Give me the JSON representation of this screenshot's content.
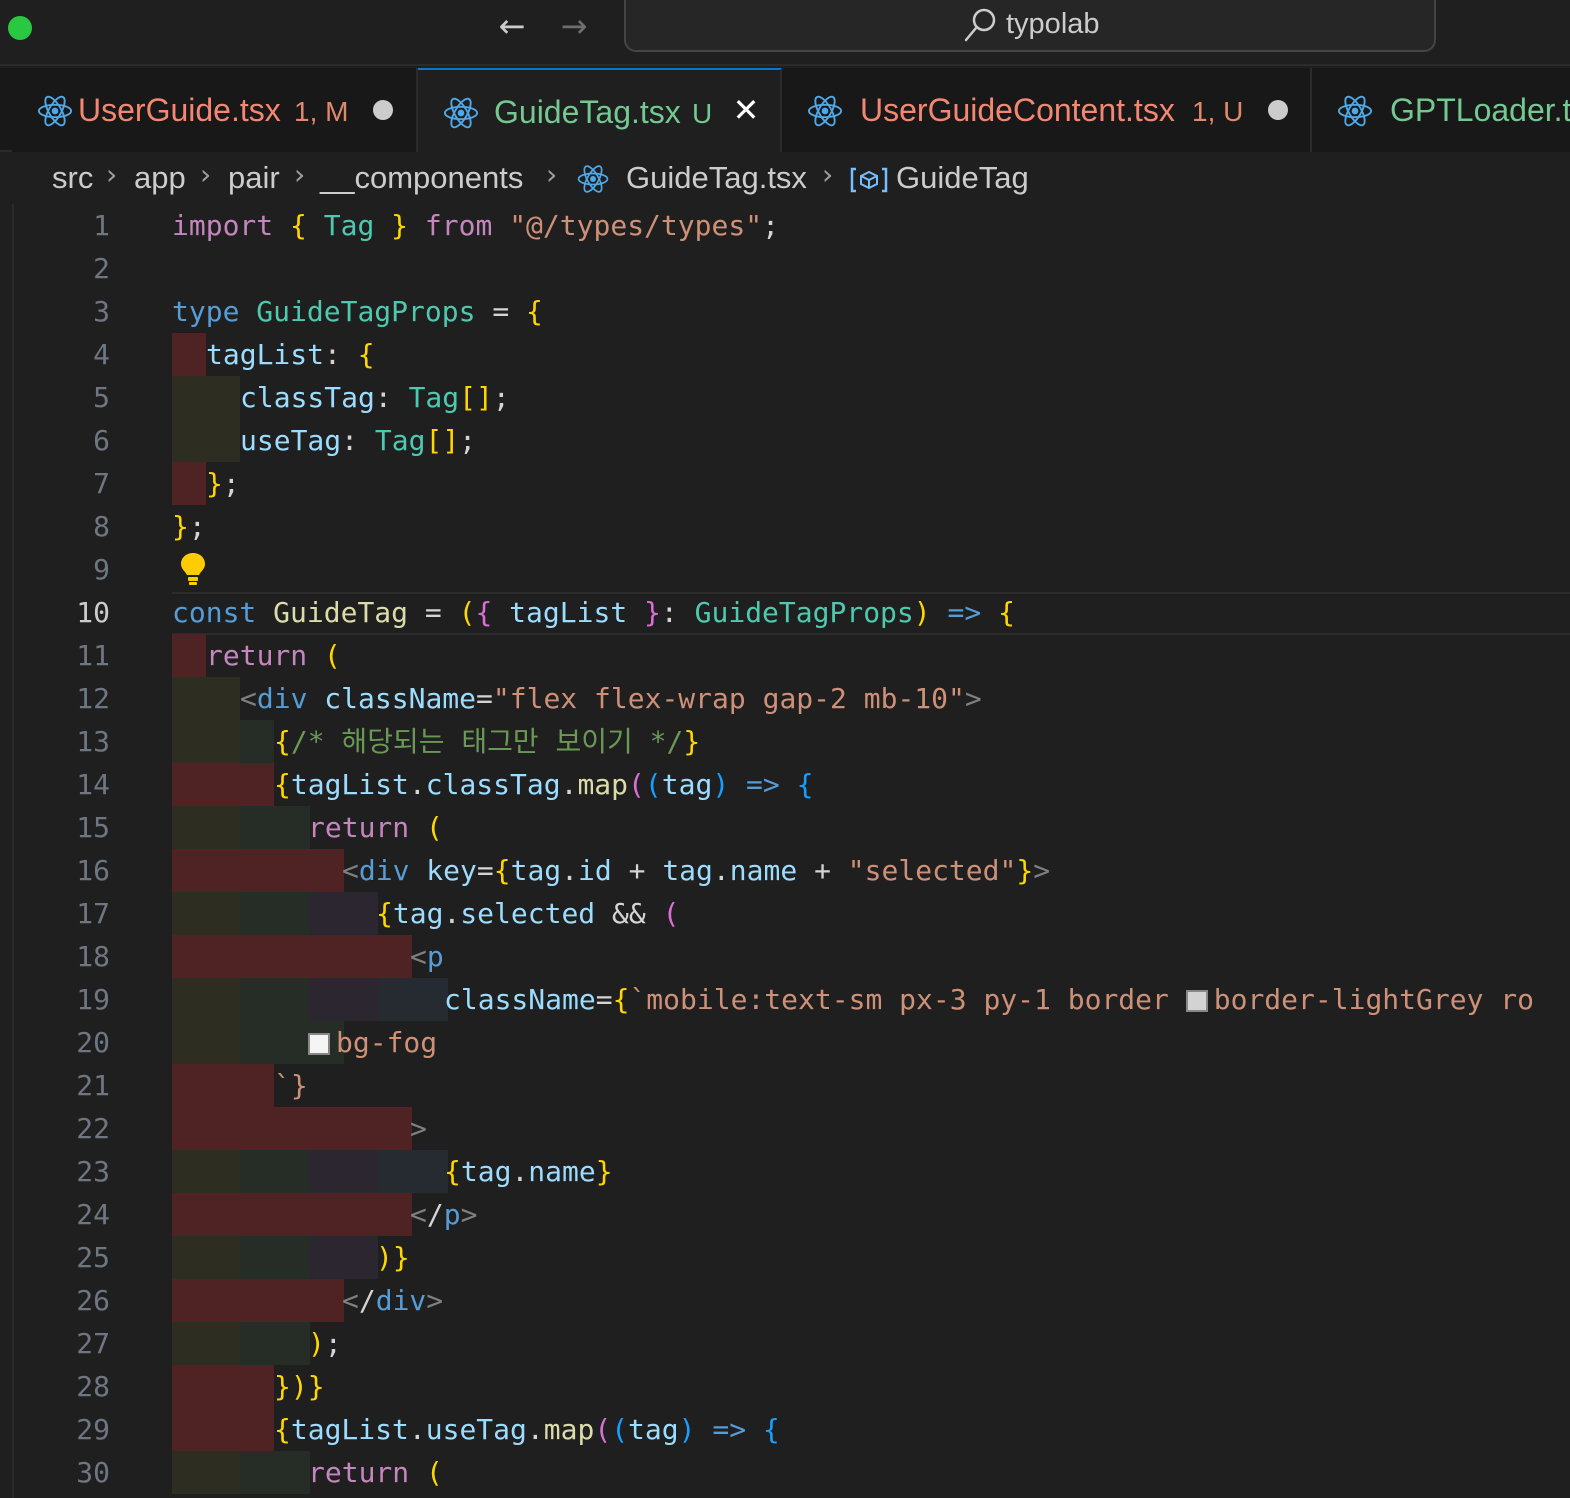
{
  "window": {
    "search_text": "typolab"
  },
  "tabs": [
    {
      "name": "UserGuide.tsx",
      "status": "1, M",
      "modified": true,
      "active": false
    },
    {
      "name": "GuideTag.tsx",
      "status": "U",
      "modified": false,
      "active": true
    },
    {
      "name": "UserGuideContent.tsx",
      "status": "1, U",
      "modified": true,
      "active": false
    },
    {
      "name": "GPTLoader.t",
      "status": "",
      "modified": false,
      "active": false
    }
  ],
  "breadcrumb": [
    "src",
    "app",
    "pair",
    "__components",
    "GuideTag.tsx",
    "GuideTag"
  ],
  "editor": {
    "current_line": 10,
    "line_numbers": [
      "1",
      "2",
      "3",
      "4",
      "5",
      "6",
      "7",
      "8",
      "9",
      "10",
      "11",
      "12",
      "13",
      "14",
      "15",
      "16",
      "17",
      "18",
      "19",
      "20",
      "21",
      "22",
      "23",
      "24",
      "25",
      "26",
      "27",
      "28",
      "29",
      "30"
    ],
    "lines": [
      "import { Tag } from \"@/types/types\";",
      "",
      "type GuideTagProps = {",
      "  tagList: {",
      "    classTag: Tag[];",
      "    useTag: Tag[];",
      "  };",
      "};",
      "",
      "const GuideTag = ({ tagList }: GuideTagProps) => {",
      "  return (",
      "    <div className=\"flex flex-wrap gap-2 mb-10\">",
      "      {/* 해당되는 태그만 보이기 */}",
      "      {tagList.classTag.map((tag) => {",
      "        return (",
      "          <div key={tag.id + tag.name + \"selected\"}>",
      "            {tag.selected && (",
      "              <p",
      "                className={`mobile:text-sm px-3 py-1 border border-lightGrey ro",
      "        bg-fog",
      "      `}",
      "              >",
      "                {tag.name}",
      "              </p>",
      "            )}",
      "          </div>",
      "        );",
      "      })}",
      "      {tagList.useTag.map((tag) => {",
      "        return ("
    ]
  },
  "colors": {
    "accent": "#0078d4",
    "modified_tab": "#f48771",
    "untracked_tab": "#73c991",
    "swatch_lightGrey": "#d3d3d3",
    "swatch_fog": "#f5f5f5"
  },
  "icons": [
    "react-icon",
    "search-icon",
    "lightbulb-icon",
    "symbol-variable-icon",
    "arrow-left-icon",
    "arrow-right-icon",
    "close-icon"
  ]
}
